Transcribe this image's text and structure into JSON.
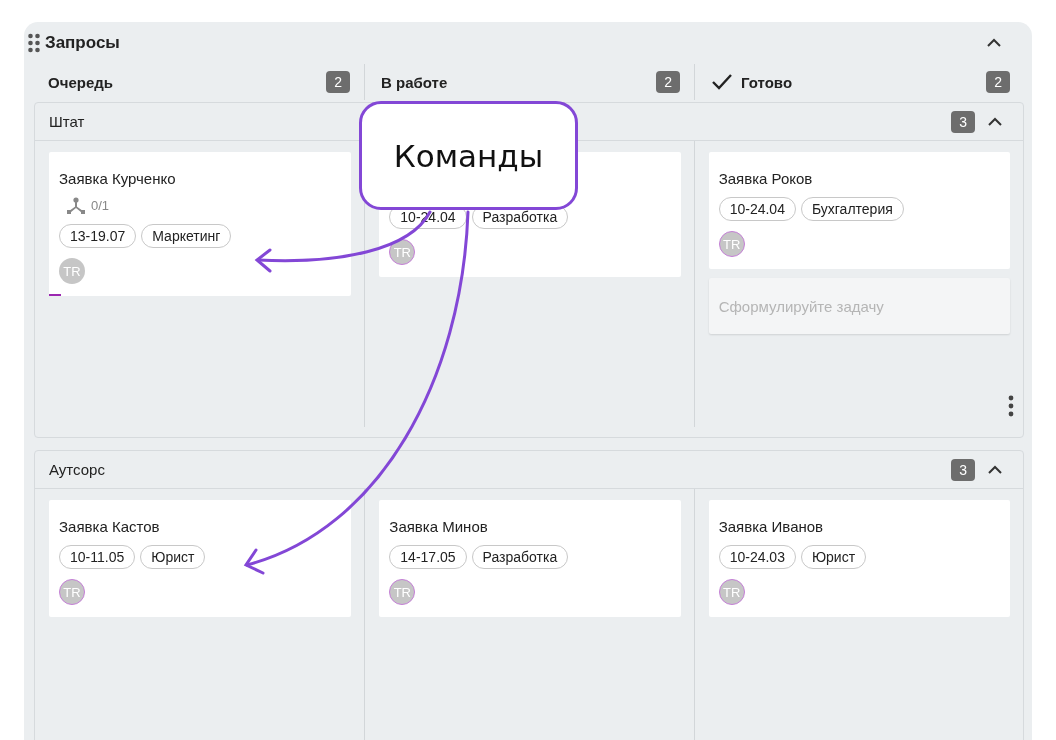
{
  "title": "Запросы",
  "expanded": true,
  "columns": [
    {
      "label": "Очередь",
      "count": "2",
      "done": false
    },
    {
      "label": "В работе",
      "count": "2",
      "done": false
    },
    {
      "label": "Готово",
      "count": "2",
      "done": true
    }
  ],
  "lanes": [
    {
      "name": "Штат",
      "count": "3",
      "expanded": true,
      "menu": true,
      "cells": [
        [
          {
            "kind": "card",
            "title": "Заявка Курченко",
            "subtasks": "0/1",
            "tags": [
              "13-19.07",
              "Маркетинг"
            ],
            "avatar": "TR",
            "ringed": false,
            "progress": {
              "level": 0.04
            }
          }
        ],
        [
          {
            "kind": "card",
            "tags": [
              "10-24.04",
              "Разработка"
            ],
            "avatar": "TR",
            "ringed": true
          }
        ],
        [
          {
            "kind": "card",
            "title": "Заявка Роков",
            "tags": [
              "10-24.04",
              "Бухгалтерия"
            ],
            "avatar": "TR",
            "ringed": true
          },
          {
            "kind": "input",
            "placeholder": "Сформулируйте задачу"
          }
        ]
      ]
    },
    {
      "name": "Аутсорс",
      "count": "3",
      "expanded": true,
      "menu": false,
      "cells": [
        [
          {
            "kind": "card",
            "title": "Заявка Кастов",
            "tags": [
              "10-11.05",
              "Юрист"
            ],
            "avatar": "TR",
            "ringed": true
          }
        ],
        [
          {
            "kind": "card",
            "title": "Заявка Минов",
            "tags": [
              "14-17.05",
              "Разработка"
            ],
            "avatar": "TR",
            "ringed": true
          }
        ],
        [
          {
            "kind": "card",
            "title": "Заявка Иванов",
            "tags": [
              "10-24.03",
              "Юрист"
            ],
            "avatar": "TR",
            "ringed": true
          }
        ]
      ]
    }
  ],
  "callout": {
    "label": "Команды"
  }
}
